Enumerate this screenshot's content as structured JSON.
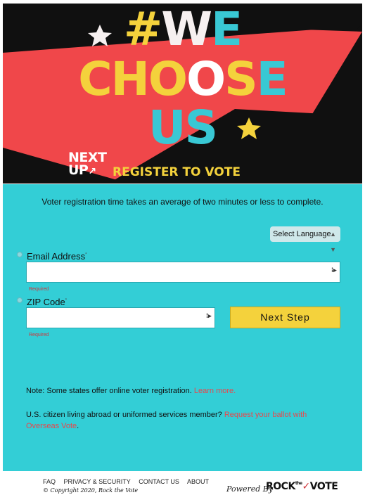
{
  "hero": {
    "line1_hash": "#",
    "line1_w": "W",
    "line1_e": "E",
    "line2_cho": "CHO",
    "line2_o": "O",
    "line2_s": "S",
    "line2_e": "E",
    "line3": "US",
    "logo_next": "NEXT",
    "logo_up": "UP",
    "register_text": "REGISTER TO VOTE",
    "colors": {
      "red": "#f0474a",
      "yellow": "#f4d23c",
      "teal": "#39c8d4",
      "black": "#101010"
    }
  },
  "form": {
    "intro": "Voter registration time takes an average of two minutes or less to complete.",
    "language_select": "Select Language",
    "email_label": "Email Address",
    "email_value": "",
    "email_required": "Required",
    "zip_label": "ZIP Code",
    "zip_value": "",
    "zip_required": "Required",
    "next_button": "Next Step",
    "note1_text": "Note: Some states offer online voter registration. ",
    "note1_link": "Learn more.",
    "note2_text": "U.S. citizen living abroad or uniformed services member? ",
    "note2_link": "Request your ballot with Overseas Vote",
    "note2_end": ".",
    "background": "#33ced6"
  },
  "footer": {
    "links": [
      "FAQ",
      "PRIVACY & SECURITY",
      "CONTACT US",
      "ABOUT"
    ],
    "copyright": "© Copyright 2020, Rock the Vote",
    "powered_by": "Powered By",
    "brand_rock": "ROCK",
    "brand_the": "the",
    "brand_vote": "VOTE"
  }
}
